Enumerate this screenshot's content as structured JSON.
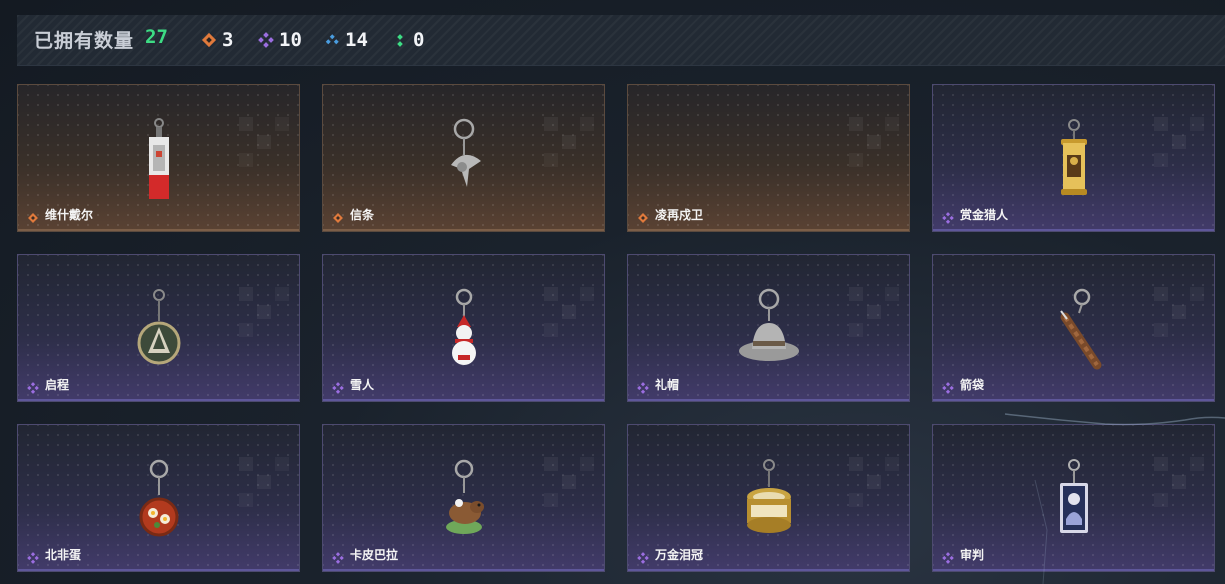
{
  "header": {
    "owned_label": "已拥有数量",
    "owned_count": "27",
    "stats": [
      {
        "icon": "orange-diamond-icon",
        "color": "#e07a3c",
        "value": "3"
      },
      {
        "icon": "purple-diamond-icon",
        "color": "#9b6ee0",
        "value": "10"
      },
      {
        "icon": "blue-triangle-icon",
        "color": "#4a9de0",
        "value": "14"
      },
      {
        "icon": "green-dots-icon",
        "color": "#3ddc84",
        "value": "0"
      }
    ]
  },
  "colors": {
    "orange": "#e07a3c",
    "purple": "#9b6ee0",
    "count_green": "#3ddc84"
  },
  "items": [
    {
      "name": "维什戴尔",
      "rarity": "orange",
      "icon": "vishdel-charm-icon"
    },
    {
      "name": "信条",
      "rarity": "orange",
      "icon": "creed-charm-icon"
    },
    {
      "name": "凌再戍卫",
      "rarity": "orange",
      "icon": ""
    },
    {
      "name": "赏金猎人",
      "rarity": "purple",
      "icon": "bounty-poster-charm-icon"
    },
    {
      "name": "启程",
      "rarity": "purple",
      "icon": "departure-medal-charm-icon"
    },
    {
      "name": "雪人",
      "rarity": "purple",
      "icon": "snowman-charm-icon"
    },
    {
      "name": "礼帽",
      "rarity": "purple",
      "icon": "hat-charm-icon"
    },
    {
      "name": "箭袋",
      "rarity": "purple",
      "icon": "quiver-charm-icon"
    },
    {
      "name": "北非蛋",
      "rarity": "purple",
      "icon": "shakshuka-charm-icon"
    },
    {
      "name": "卡皮巴拉",
      "rarity": "purple",
      "icon": "capybara-charm-icon"
    },
    {
      "name": "万金泪冠",
      "rarity": "purple",
      "icon": "golden-crown-charm-icon"
    },
    {
      "name": "审判",
      "rarity": "purple",
      "icon": "judgment-card-charm-icon"
    }
  ]
}
